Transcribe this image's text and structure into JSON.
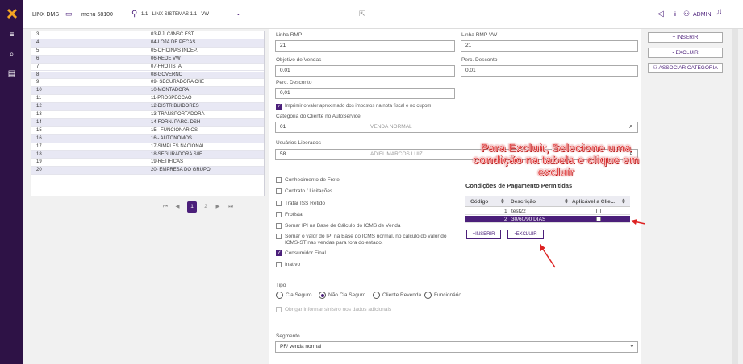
{
  "topbar": {
    "app_name": "LINX DMS",
    "menu": "menu 58100",
    "company": "1.1 - LINX SISTEMAS 1.1 - VW",
    "user": "ADMIN",
    "info": "i"
  },
  "list": {
    "rows": [
      {
        "code": "3",
        "name": "03-P.J. C/INSC.EST"
      },
      {
        "code": "4",
        "name": "04-LOJA DE PECAS"
      },
      {
        "code": "5",
        "name": "05-OFICINAS INDEP."
      },
      {
        "code": "6",
        "name": "06-REDE VW"
      },
      {
        "code": "7",
        "name": "07-FROTISTA"
      },
      {
        "code": "8",
        "name": "08-GOVERNO"
      },
      {
        "code": "9",
        "name": "09- SEGURADORA C/IE"
      },
      {
        "code": "10",
        "name": "10-MONTADORA"
      },
      {
        "code": "11",
        "name": "11-PROSPECCAO"
      },
      {
        "code": "12",
        "name": "12-DISTRIBUIDORES"
      },
      {
        "code": "13",
        "name": "13-TRANSPORTADORA"
      },
      {
        "code": "14",
        "name": "14-FORN. PARC. DSH"
      },
      {
        "code": "15",
        "name": "15 - FUNCIONARIOS"
      },
      {
        "code": "16",
        "name": "16 - AUTONOMOS"
      },
      {
        "code": "17",
        "name": "17-SIMPLES NACIONAL"
      },
      {
        "code": "18",
        "name": "18-SEGURADORA S/IE"
      },
      {
        "code": "19",
        "name": "19-RETIFICAS"
      },
      {
        "code": "20",
        "name": "20- EMPRESA DO GRUPO"
      }
    ],
    "pages": [
      "1",
      "2"
    ]
  },
  "form": {
    "linha_rmp_label": "Linha RMP",
    "linha_rmp_value": "21",
    "linha_rmp_vw_label": "Linha RMP VW",
    "linha_rmp_vw_value": "21",
    "objetivo_label": "Objetivo de Vendas",
    "objetivo_value": "0,01",
    "perc_desconto_label": "Perc. Desconto",
    "perc_desconto_value": "0,01",
    "perc_desconto2_label": "Perc. Desconto",
    "perc_desconto2_value": "0,01",
    "imprimir_label": "Imprimir o valor aproximado dos impostos na nota fiscal e no cupom",
    "categoria_label": "Categoria do Cliente no AutoService",
    "categoria_code": "01",
    "categoria_desc": "VENDA NORMAL",
    "usuarios_label": "Usuários Liberados",
    "usuarios_code": "58",
    "usuarios_desc": "ADIEL MARCOS LUIZ",
    "checks": [
      {
        "label": "Conhecimento de Frete",
        "checked": false
      },
      {
        "label": "Contrato / Licitações",
        "checked": false
      },
      {
        "label": "Tratar ISS Retido",
        "checked": false
      },
      {
        "label": "Frotista",
        "checked": false
      },
      {
        "label": "Somar IPI na Base de Cálculo do ICMS de Venda",
        "checked": false
      },
      {
        "label": "Somar o valor do IPI na Base do ICMS normal, no cálculo do valor do",
        "label2": "ICMS-ST nas vendas para fora do estado.",
        "checked": false
      },
      {
        "label": "Consumidor Final",
        "checked": true
      },
      {
        "label": "Inativo",
        "checked": false
      }
    ],
    "tipo_label": "Tipo",
    "tipo_options": [
      "Cia Seguro",
      "Não Cia Seguro",
      "Cliente Revenda",
      "Funcionário"
    ],
    "tipo_selected": "Não Cia Seguro",
    "sinistro_label": "Obrigar informar sinistro nos dados adicionais",
    "segmento_label": "Segmento",
    "segmento_value": "PF/ venda normal"
  },
  "payment": {
    "title": "Condições de Pagamento Permitidas",
    "col_codigo": "Código",
    "col_descricao": "Descrição",
    "col_aplicavel": "Aplicável a Clie...",
    "rows": [
      {
        "code": "1",
        "desc": "test22",
        "selected": false
      },
      {
        "code": "2",
        "desc": "30/60/90 DIAS",
        "selected": true
      }
    ],
    "btn_inserir": "+INSERIR",
    "btn_excluir": "EXCLUIR"
  },
  "annotation": {
    "line1": "Para Excluir, Selecione uma",
    "line2": "condição na tabela e clique em",
    "line3": "excluir"
  },
  "actions": {
    "inserir": "+ INSERIR",
    "excluir": "EXCLUIR",
    "associar": "ASSOCIAR CATEGORIA"
  },
  "colors": {
    "brand": "#2e1246",
    "accent": "#4b1f7a",
    "annotation": "#e24040"
  }
}
